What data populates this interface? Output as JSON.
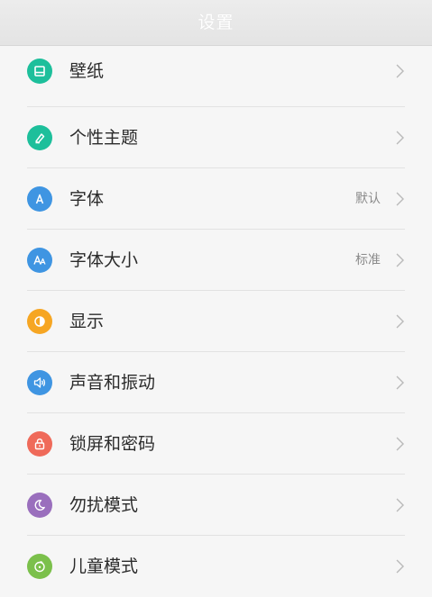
{
  "header": {
    "title": "设置"
  },
  "colors": {
    "wallpaper": "#1dbf9b",
    "theme": "#1dbf9b",
    "font": "#3f95e2",
    "font_size": "#3f95e2",
    "display": "#f6a623",
    "sound": "#3f95e2",
    "lock": "#ef6a5a",
    "dnd": "#9a6fbd",
    "kids": "#7bc04b"
  },
  "settings": {
    "items": [
      {
        "label": "壁纸",
        "icon": "wallpaper-icon"
      },
      {
        "label": "个性主题",
        "icon": "theme-brush-icon"
      },
      {
        "label": "字体",
        "icon": "font-icon",
        "value": "默认"
      },
      {
        "label": "字体大小",
        "icon": "font-size-icon",
        "value": "标准"
      },
      {
        "label": "显示",
        "icon": "display-brightness-icon"
      },
      {
        "label": "声音和振动",
        "icon": "speaker-icon"
      },
      {
        "label": "锁屏和密码",
        "icon": "lock-icon"
      },
      {
        "label": "勿扰模式",
        "icon": "moon-icon"
      },
      {
        "label": "儿童模式",
        "icon": "kids-face-icon"
      }
    ]
  }
}
